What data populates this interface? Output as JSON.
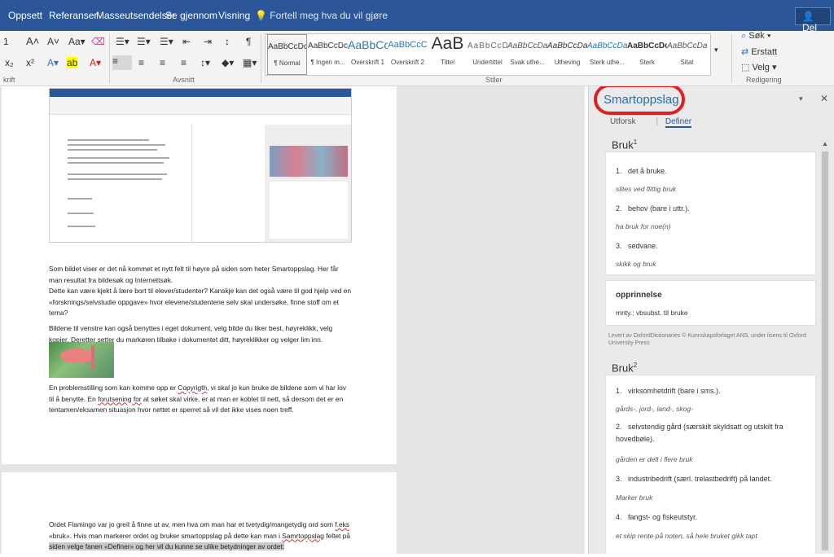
{
  "tabs": [
    "Oppsett",
    "Referanser",
    "Masseutsendelser",
    "Se gjennom",
    "Visning"
  ],
  "tellme": "Fortell meg hva du vil gjøre",
  "share": "Del",
  "ribbon": {
    "font_size": "1",
    "font_group": "krift",
    "para_group": "Avsnitt",
    "styles_group": "Stiler",
    "edit_group": "Redigering",
    "find": "Søk",
    "replace": "Erstatt",
    "select": "Velg"
  },
  "styles": [
    {
      "preview": "AaBbCcDc",
      "name": "¶ Normal"
    },
    {
      "preview": "AaBbCcDc",
      "name": "¶ Ingen m..."
    },
    {
      "preview": "AaBbCc",
      "name": "Overskrift 1"
    },
    {
      "preview": "AaBbCcC",
      "name": "Overskrift 2"
    },
    {
      "preview": "AaB",
      "name": "Tittel"
    },
    {
      "preview": "AaBbCcD",
      "name": "Undertittel"
    },
    {
      "preview": "AaBbCcDa",
      "name": "Svak uthe..."
    },
    {
      "preview": "AaBbCcDa",
      "name": "Utheving"
    },
    {
      "preview": "AaBbCcDa",
      "name": "Sterk uthe..."
    },
    {
      "preview": "AaBbCcDc",
      "name": "Sterk"
    },
    {
      "preview": "AaBbCcDa",
      "name": "Sitat"
    }
  ],
  "doc": {
    "p1": "Som bildet viser er det nå kommet et nytt felt til høyre på siden som heter Smartoppslag. Her får man resultat fra bildesøk og Internettsøk.",
    "p2": "Dette kan være kjekt å lære bort til elever/studenter? Kanskje kan det også være til god hjelp ved en «forsknings/selvstudie oppgave» hvor elevene/studentene selv skal undersøke, finne stoff om et tema?",
    "p3": "Bildene til venstre kan også benyttes i eget dokument, velg bilde du liker best, høyreklikk, velg kopier. Deretter setter du markøren tilbake i dokumentet ditt, høyreklikker og velger lim inn.",
    "p4a": "En problemstilling som kan komme opp er ",
    "p4b": "Copyrigth",
    "p4c": ", vi skal jo kun bruke de bildene som vi har lov til å benytte. En ",
    "p4d": "forutsening  for",
    "p4e": " at søket skal virke, er at man er koblet til nett, så dersom det er en tentamen/eksamen situasjon hvor nettet er sperret så vil det ikke vises noen treff.",
    "p5a": " Ordet Flamingo var jo greit å finne ut av, men hva om man har et tvetydig/mangetydig ord som ",
    "p5b": "f.eks",
    "p5c": " «bruk». Hvis man markerer ordet og bruker smartoppslag på dette kan man i ",
    "p5d": "Samrtoppslag",
    "p5e": " feltet på ",
    "p5f": "siden velge fanen «Definer» og her vil du kunne se ulike betydninger av ordet:"
  },
  "pane": {
    "title": "Smartoppslag",
    "tab1": "Utforsk",
    "tab2": "Definer",
    "head1": "Bruk",
    "sup1": "1",
    "defs1": [
      {
        "n": "1.",
        "t": "det å bruke.",
        "e": "slites ved flittig bruk"
      },
      {
        "n": "2.",
        "t": "behov (bare i uttr.).",
        "e": "ha bruk for noe(n)"
      },
      {
        "n": "3.",
        "t": "sedvane.",
        "e": "skikk og bruk"
      }
    ],
    "origin_title": "opprinnelse",
    "origin": "mnty.; vbsubst. til bruke",
    "credit": "Levert av OxfordDictionaries © Kunnskapsforlaget ANS, under lisens til Oxford University Press",
    "head2": "Bruk",
    "sup2": "2",
    "d2_1": "virksomhetdrift (bare i sms.).",
    "e2_1": "gårds-, jord-, land-, skog-",
    "d2_2": "selvstendig gård (særskilt skyldsatt og utskilt fra hovedbøle).",
    "e2_2": "gården er delt i flere bruk",
    "d2_3": "industribedrift (særl. trelastbedrift) på landet.",
    "e2_3": "Marker bruk",
    "d2_4": "fangst- og fiskeutstyr.",
    "e2_4": "et skip rente på noten, så hele bruket gikk tapt",
    "n1": "1.",
    "n2": "2.",
    "n3": "3.",
    "n4": "4."
  },
  "colors": {
    "accent": "#2b579a",
    "highlight": "#e02020"
  },
  "icons": [
    "lightbulb-icon",
    "person-icon",
    "search-icon",
    "replace-icon",
    "select-icon",
    "close-icon",
    "flamingo-image"
  ]
}
